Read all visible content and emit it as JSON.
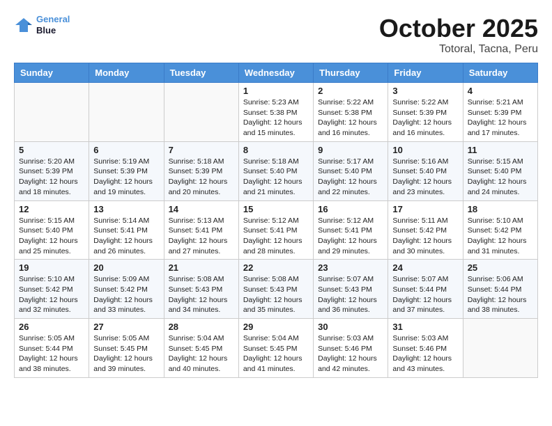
{
  "header": {
    "logo_line1": "General",
    "logo_line2": "Blue",
    "main_title": "October 2025",
    "sub_title": "Totoral, Tacna, Peru"
  },
  "days_of_week": [
    "Sunday",
    "Monday",
    "Tuesday",
    "Wednesday",
    "Thursday",
    "Friday",
    "Saturday"
  ],
  "weeks": [
    [
      {
        "day": "",
        "info": ""
      },
      {
        "day": "",
        "info": ""
      },
      {
        "day": "",
        "info": ""
      },
      {
        "day": "1",
        "info": "Sunrise: 5:23 AM\nSunset: 5:38 PM\nDaylight: 12 hours\nand 15 minutes."
      },
      {
        "day": "2",
        "info": "Sunrise: 5:22 AM\nSunset: 5:38 PM\nDaylight: 12 hours\nand 16 minutes."
      },
      {
        "day": "3",
        "info": "Sunrise: 5:22 AM\nSunset: 5:39 PM\nDaylight: 12 hours\nand 16 minutes."
      },
      {
        "day": "4",
        "info": "Sunrise: 5:21 AM\nSunset: 5:39 PM\nDaylight: 12 hours\nand 17 minutes."
      }
    ],
    [
      {
        "day": "5",
        "info": "Sunrise: 5:20 AM\nSunset: 5:39 PM\nDaylight: 12 hours\nand 18 minutes."
      },
      {
        "day": "6",
        "info": "Sunrise: 5:19 AM\nSunset: 5:39 PM\nDaylight: 12 hours\nand 19 minutes."
      },
      {
        "day": "7",
        "info": "Sunrise: 5:18 AM\nSunset: 5:39 PM\nDaylight: 12 hours\nand 20 minutes."
      },
      {
        "day": "8",
        "info": "Sunrise: 5:18 AM\nSunset: 5:40 PM\nDaylight: 12 hours\nand 21 minutes."
      },
      {
        "day": "9",
        "info": "Sunrise: 5:17 AM\nSunset: 5:40 PM\nDaylight: 12 hours\nand 22 minutes."
      },
      {
        "day": "10",
        "info": "Sunrise: 5:16 AM\nSunset: 5:40 PM\nDaylight: 12 hours\nand 23 minutes."
      },
      {
        "day": "11",
        "info": "Sunrise: 5:15 AM\nSunset: 5:40 PM\nDaylight: 12 hours\nand 24 minutes."
      }
    ],
    [
      {
        "day": "12",
        "info": "Sunrise: 5:15 AM\nSunset: 5:40 PM\nDaylight: 12 hours\nand 25 minutes."
      },
      {
        "day": "13",
        "info": "Sunrise: 5:14 AM\nSunset: 5:41 PM\nDaylight: 12 hours\nand 26 minutes."
      },
      {
        "day": "14",
        "info": "Sunrise: 5:13 AM\nSunset: 5:41 PM\nDaylight: 12 hours\nand 27 minutes."
      },
      {
        "day": "15",
        "info": "Sunrise: 5:12 AM\nSunset: 5:41 PM\nDaylight: 12 hours\nand 28 minutes."
      },
      {
        "day": "16",
        "info": "Sunrise: 5:12 AM\nSunset: 5:41 PM\nDaylight: 12 hours\nand 29 minutes."
      },
      {
        "day": "17",
        "info": "Sunrise: 5:11 AM\nSunset: 5:42 PM\nDaylight: 12 hours\nand 30 minutes."
      },
      {
        "day": "18",
        "info": "Sunrise: 5:10 AM\nSunset: 5:42 PM\nDaylight: 12 hours\nand 31 minutes."
      }
    ],
    [
      {
        "day": "19",
        "info": "Sunrise: 5:10 AM\nSunset: 5:42 PM\nDaylight: 12 hours\nand 32 minutes."
      },
      {
        "day": "20",
        "info": "Sunrise: 5:09 AM\nSunset: 5:42 PM\nDaylight: 12 hours\nand 33 minutes."
      },
      {
        "day": "21",
        "info": "Sunrise: 5:08 AM\nSunset: 5:43 PM\nDaylight: 12 hours\nand 34 minutes."
      },
      {
        "day": "22",
        "info": "Sunrise: 5:08 AM\nSunset: 5:43 PM\nDaylight: 12 hours\nand 35 minutes."
      },
      {
        "day": "23",
        "info": "Sunrise: 5:07 AM\nSunset: 5:43 PM\nDaylight: 12 hours\nand 36 minutes."
      },
      {
        "day": "24",
        "info": "Sunrise: 5:07 AM\nSunset: 5:44 PM\nDaylight: 12 hours\nand 37 minutes."
      },
      {
        "day": "25",
        "info": "Sunrise: 5:06 AM\nSunset: 5:44 PM\nDaylight: 12 hours\nand 38 minutes."
      }
    ],
    [
      {
        "day": "26",
        "info": "Sunrise: 5:05 AM\nSunset: 5:44 PM\nDaylight: 12 hours\nand 38 minutes."
      },
      {
        "day": "27",
        "info": "Sunrise: 5:05 AM\nSunset: 5:45 PM\nDaylight: 12 hours\nand 39 minutes."
      },
      {
        "day": "28",
        "info": "Sunrise: 5:04 AM\nSunset: 5:45 PM\nDaylight: 12 hours\nand 40 minutes."
      },
      {
        "day": "29",
        "info": "Sunrise: 5:04 AM\nSunset: 5:45 PM\nDaylight: 12 hours\nand 41 minutes."
      },
      {
        "day": "30",
        "info": "Sunrise: 5:03 AM\nSunset: 5:46 PM\nDaylight: 12 hours\nand 42 minutes."
      },
      {
        "day": "31",
        "info": "Sunrise: 5:03 AM\nSunset: 5:46 PM\nDaylight: 12 hours\nand 43 minutes."
      },
      {
        "day": "",
        "info": ""
      }
    ]
  ]
}
